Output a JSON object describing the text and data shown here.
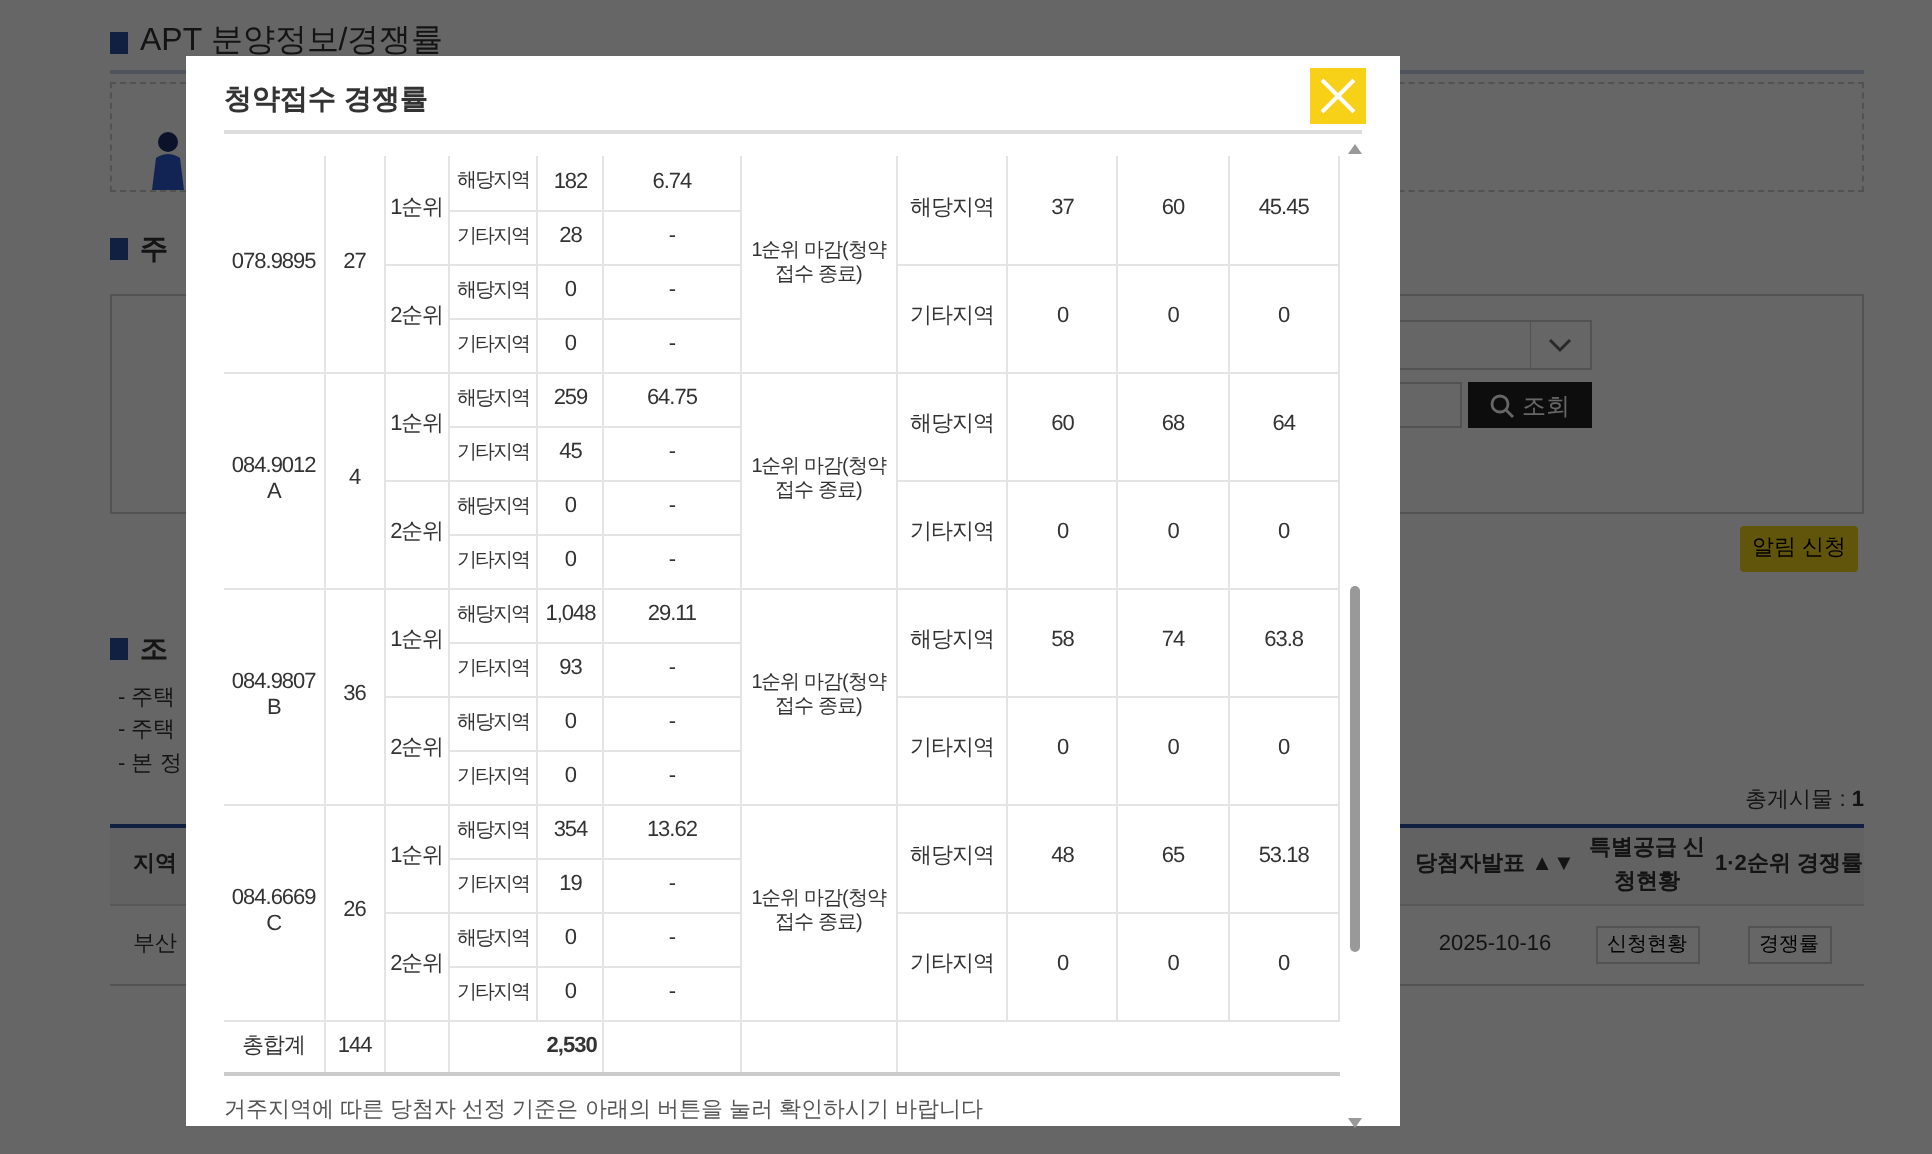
{
  "page": {
    "title": "APT 분양정보/경쟁률",
    "section_1": "주",
    "section_2": "조",
    "search_button": "조회",
    "alert_button": "알림 신청",
    "notes": [
      "- 주택",
      "- 주택",
      "- 본 정"
    ],
    "total": "총게시물 : **1**",
    "table": {
      "columns": [
        "지역",
        "당첨자발표 ▲▼",
        "특별공급 신청현황",
        "1·2순위 경쟁률"
      ],
      "rows": [
        {
          "region": "부산",
          "announce_date": "2025-10-16",
          "special_button": "신청현황",
          "rate_button": "경쟁률"
        }
      ]
    }
  },
  "modal": {
    "title": "청약접수 경쟁률",
    "groups": [
      {
        "size": "078.9895",
        "units": "27",
        "ranks": [
          {
            "label": "1순위",
            "rows": [
              {
                "area": "해당지역",
                "applicants": "182",
                "ratio": "6.74"
              },
              {
                "area": "기타지역",
                "applicants": "28",
                "ratio": "-"
              }
            ]
          },
          {
            "label": "2순위",
            "rows": [
              {
                "area": "해당지역",
                "applicants": "0",
                "ratio": "-"
              },
              {
                "area": "기타지역",
                "applicants": "0",
                "ratio": "-"
              }
            ]
          }
        ],
        "result": "1순위 마감(청약 접수 종료)",
        "scores": [
          {
            "area": "해당지역",
            "lowest": "37",
            "highest": "60",
            "average": "45.45"
          },
          {
            "area": "기타지역",
            "lowest": "0",
            "highest": "0",
            "average": "0"
          }
        ]
      },
      {
        "size": "084.9012 A",
        "units": "4",
        "ranks": [
          {
            "label": "1순위",
            "rows": [
              {
                "area": "해당지역",
                "applicants": "259",
                "ratio": "64.75"
              },
              {
                "area": "기타지역",
                "applicants": "45",
                "ratio": "-"
              }
            ]
          },
          {
            "label": "2순위",
            "rows": [
              {
                "area": "해당지역",
                "applicants": "0",
                "ratio": "-"
              },
              {
                "area": "기타지역",
                "applicants": "0",
                "ratio": "-"
              }
            ]
          }
        ],
        "result": "1순위 마감(청약 접수 종료)",
        "scores": [
          {
            "area": "해당지역",
            "lowest": "60",
            "highest": "68",
            "average": "64"
          },
          {
            "area": "기타지역",
            "lowest": "0",
            "highest": "0",
            "average": "0"
          }
        ]
      },
      {
        "size": "084.9807 B",
        "units": "36",
        "ranks": [
          {
            "label": "1순위",
            "rows": [
              {
                "area": "해당지역",
                "applicants": "1,048",
                "ratio": "29.11"
              },
              {
                "area": "기타지역",
                "applicants": "93",
                "ratio": "-"
              }
            ]
          },
          {
            "label": "2순위",
            "rows": [
              {
                "area": "해당지역",
                "applicants": "0",
                "ratio": "-"
              },
              {
                "area": "기타지역",
                "applicants": "0",
                "ratio": "-"
              }
            ]
          }
        ],
        "result": "1순위 마감(청약 접수 종료)",
        "scores": [
          {
            "area": "해당지역",
            "lowest": "58",
            "highest": "74",
            "average": "63.8"
          },
          {
            "area": "기타지역",
            "lowest": "0",
            "highest": "0",
            "average": "0"
          }
        ]
      },
      {
        "size": "084.6669 C",
        "units": "26",
        "ranks": [
          {
            "label": "1순위",
            "rows": [
              {
                "area": "해당지역",
                "applicants": "354",
                "ratio": "13.62"
              },
              {
                "area": "기타지역",
                "applicants": "19",
                "ratio": "-"
              }
            ]
          },
          {
            "label": "2순위",
            "rows": [
              {
                "area": "해당지역",
                "applicants": "0",
                "ratio": "-"
              },
              {
                "area": "기타지역",
                "applicants": "0",
                "ratio": "-"
              }
            ]
          }
        ],
        "result": "1순위 마감(청약 접수 종료)",
        "scores": [
          {
            "area": "해당지역",
            "lowest": "48",
            "highest": "65",
            "average": "53.18"
          },
          {
            "area": "기타지역",
            "lowest": "0",
            "highest": "0",
            "average": "0"
          }
        ]
      }
    ],
    "total": {
      "label": "총합계",
      "units": "144",
      "applicants": "2,530"
    },
    "note": "거주지역에 따른 당첨자 선정 기준은 아래의 버튼을 눌러 확인하시기 바랍니다"
  }
}
